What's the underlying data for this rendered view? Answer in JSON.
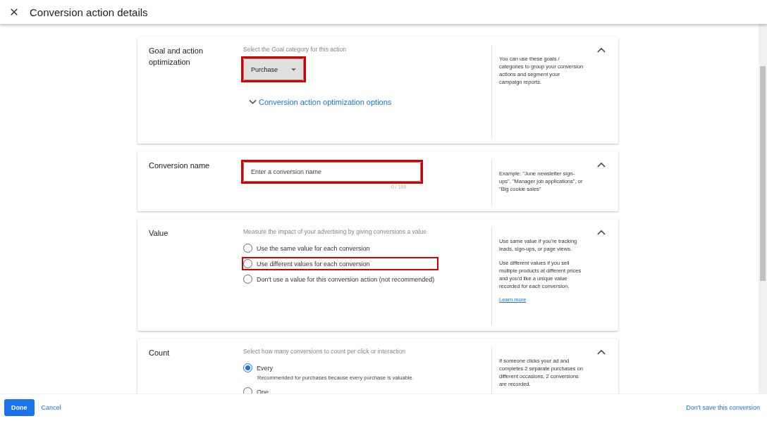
{
  "window": {
    "title": "Conversion action details"
  },
  "sections": [
    {
      "kind": "dropdown",
      "label": "Goal and action optimization",
      "instruction": "Select the Goal category for this action",
      "dropdown": {
        "value": "Purchase",
        "highlighted": true
      },
      "link": "Conversion action optimization options",
      "help": [
        "You can use these goals / categories to group your conversion actions and segment your campaign reports."
      ],
      "expanded": true
    },
    {
      "kind": "text",
      "label": "Conversion name",
      "field": {
        "placeholder": "Enter a conversion name",
        "counter": "0 / 100",
        "highlighted": true
      },
      "help": [
        "Example: \"June newsletter sign-ups\", \"Manager job applications\", or \"Big cookie sales\""
      ],
      "expanded": true
    },
    {
      "kind": "radio",
      "label": "Value",
      "instruction": "Measure the impact of your advertising by giving conversions a value",
      "options": [
        {
          "label": "Use the same value for each conversion",
          "selected": false
        },
        {
          "label": "Use different values for each conversion",
          "selected": false,
          "highlighted": true
        },
        {
          "label": "Don't use a value for this conversion action (not recommended)",
          "selected": false
        }
      ],
      "help": [
        "Use same value if you're tracking leads, sign-ups, or page views.",
        "Use different values if you sell multiple products at different prices and you'd like a unique value recorded for each conversion."
      ],
      "help_link": "Learn more",
      "expanded": true
    },
    {
      "kind": "radio",
      "label": "Count",
      "instruction": "Select how many conversions to count per click or interaction",
      "options": [
        {
          "label": "Every",
          "note": "Recommended for purchases because every purchase is valuable.",
          "selected": true
        },
        {
          "label": "One",
          "selected": false
        }
      ],
      "help": [
        "If someone clicks your ad and completes 2 separate purchases on different occasions, 2 conversions are recorded."
      ],
      "expanded": true
    }
  ],
  "footer": {
    "primary": "Done",
    "secondary": "Cancel",
    "discard": "Don't save this conversion"
  }
}
